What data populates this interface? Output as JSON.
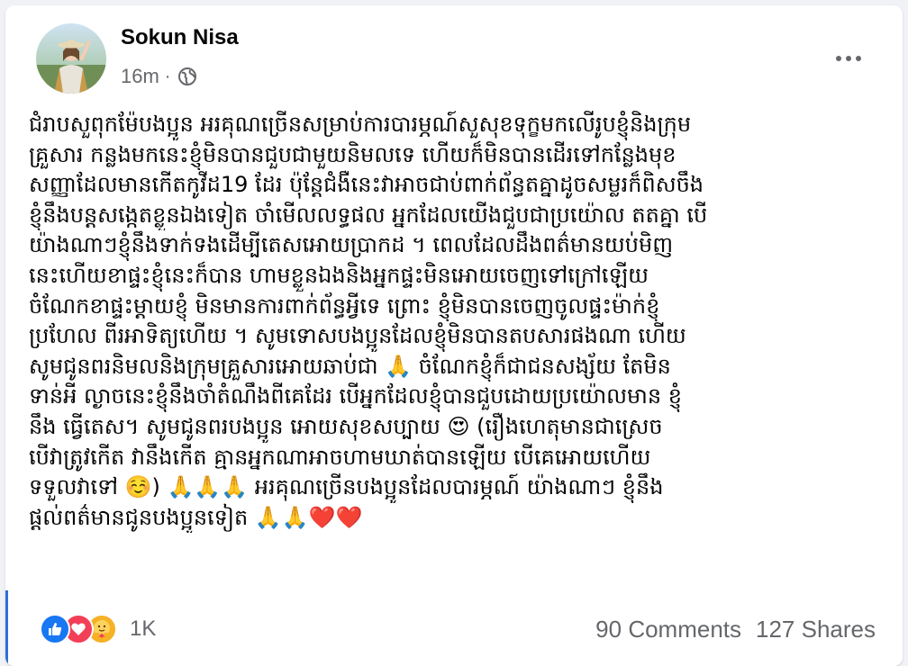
{
  "post": {
    "author": "Sokun Nisa",
    "timestamp": "16m",
    "separator": "·",
    "privacy_icon": "globe-icon",
    "more_icon": "more-options-icon",
    "text_lines": [
      "ជំរាបសួពុកម៉ែបងប្អូន  អរគុណច្រើនសម្រាប់ការបារម្ភណ៍សួសុខទុក្ខមកលើរូបខ្ញុំនិងក្រុម",
      "គ្រួសារ  កន្លងមកនេះខ្ញុំមិនបានជួបជាមួយនិមលទេ ហើយក៏មិនបានដើរទៅកន្លែងមុខ",
      "សញ្ញាដែលមានកើតកូវីដ19 ដែរ ប៉ុន្តែជំងឺនេះវាអាចជាប់ពាក់ព័ន្ធតគ្នាដូចសម្លរក៏ពិសចឹង",
      "ខ្ញុំនឹងបន្តសង្កេតខ្លួនឯងទៀត ចាំមើលលទ្ធផល អ្នកដែលយើងជួបជាប្រយ៉ោល តតគ្នា បើ",
      "យ៉ាងណាៗខ្ញុំនឹងទាក់ទងដើម្បីតេសអោយប្រាកដ ។ ពេលដែលដឹងពត៌មានយប់មិញ",
      "នេះហើយខាផ្ទះខ្ញុំនេះក៏បាន ហាមខ្លួនឯងនិងអ្នកផ្ទះមិនអោយចេញទៅក្រៅឡើយ",
      "ចំណែកខាផ្ទះម្តាយខ្ញុំ មិនមានការពាក់ព័ន្ធអ្វីទេ ព្រោះ ខ្ញុំមិនបានចេញចូលផ្ទះម៉ាក់ខ្ញុំ",
      "ប្រហែល ពីរអាទិត្យហើយ ។  សូមទោសបងប្អូនដែលខ្ញុំមិនបានតបសារផងណា ហើយ",
      "សូមជូនពរនិមលនិងក្រុមគ្រួសារអោយឆាប់ជា 🙏  ចំណែកខ្ញុំក៏ជាជនសង្ស័យ តែមិន",
      "ទាន់អី ល្ងាចនេះខ្ញុំនឹងចាំតំណឹងពីគេដែរ បើអ្នកដែលខ្ញុំបានជួបដោយប្រយ៉ោលមាន ខ្ញុំ",
      "នឹង ធ្វើតេស។ សូមជូនពរបងប្អូន អោយសុខសប្បាយ 😍  (រឿងហេតុមានជាស្រេច",
      "បើវាត្រូវកើត វានឹងកើត គ្មានអ្នកណាអាចហាមឃាត់បានឡើយ បើគេអោយហើយ",
      "ទទួលវាទៅ ☺️) 🙏🙏🙏  អរគុណច្រើនបងប្អូនដែលបារម្ភណ៍ យ៉ាងណាៗ ខ្ញុំនឹង",
      "ផ្តល់ពត៌មានជូនបងប្អូនទៀត 🙏🙏❤️❤️"
    ]
  },
  "reactions": {
    "icons": [
      "like-icon",
      "love-icon",
      "care-icon"
    ],
    "count": "1K"
  },
  "stats": {
    "comments": "90 Comments",
    "shares": "127 Shares"
  },
  "colors": {
    "like": "#1877f2",
    "love": "#f33e58",
    "care": "#f7b125",
    "secondary_text": "#65676b"
  }
}
